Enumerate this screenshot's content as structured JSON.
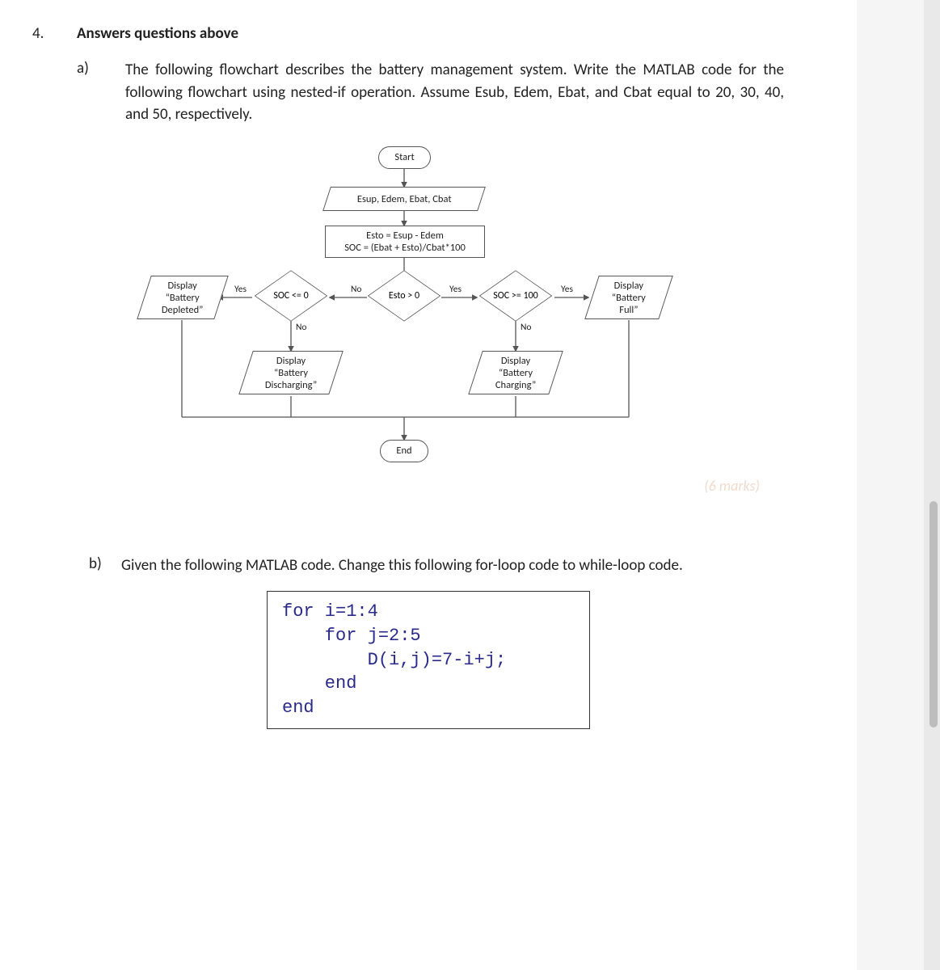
{
  "question_number": "4.",
  "heading": "Answers questions above",
  "part_a": {
    "label": "a)",
    "text": "The following flowchart describes the battery management system. Write the MATLAB code for the following flowchart using nested-if operation. Assume Esub, Edem, Ebat, and Cbat equal to 20, 30, 40, and 50, respectively."
  },
  "flowchart": {
    "start": "Start",
    "input": "Esup, Edem, Ebat, Cbat",
    "process": "Esto = Esup - Edem\nSOC = (Ebat + Esto)/Cbat*100",
    "d1": "Esto > 0",
    "d2": "SOC >= 100",
    "d3": "SOC <= 0",
    "out_full": "Display\n“Battery\nFull”",
    "out_charging": "Display\n“Battery\nCharging”",
    "out_depleted": "Display\n“Battery\nDepleted”",
    "out_discharging": "Display\n“Battery\nDischarging”",
    "end": "End",
    "yes": "Yes",
    "no": "No"
  },
  "marks_faded": "(6 marks)",
  "part_b": {
    "label": "b)",
    "text": "Given the following MATLAB code. Change this following for-loop code to while-loop code.",
    "code": "for i=1:4\n    for j=2:5\n        D(i,j)=7-i+j;\n    end\nend"
  }
}
